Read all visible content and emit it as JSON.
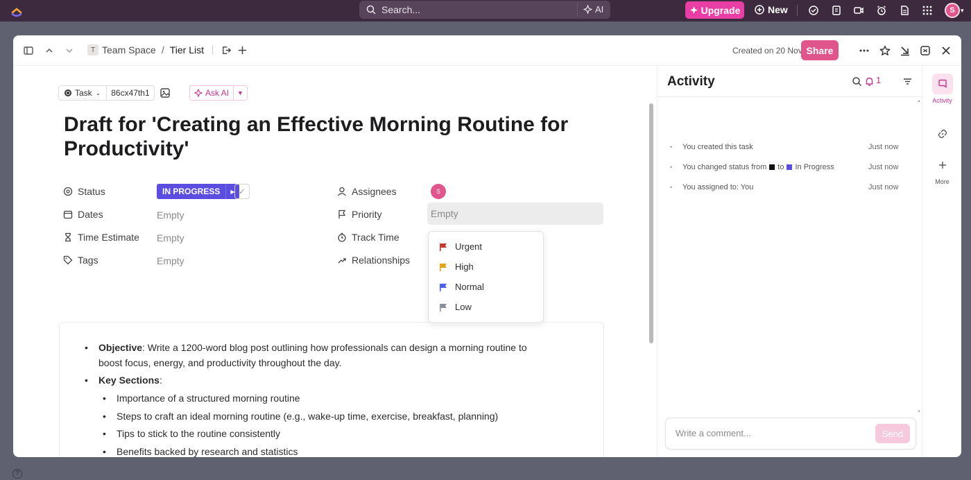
{
  "topbar": {
    "search_placeholder": "Search...",
    "ai_label": "AI",
    "upgrade_label": "Upgrade",
    "new_label": "New",
    "avatar_initial": "S"
  },
  "breadcrumb": {
    "space_initial": "T",
    "space": "Team Space",
    "separator": "/",
    "list": "Tier List"
  },
  "header": {
    "created": "Created on 20 Nov",
    "share_label": "Share"
  },
  "task": {
    "type_label": "Task",
    "task_id": "86cx47th1",
    "ask_ai_label": "Ask AI",
    "title": "Draft for 'Creating an Effective Morning Routine for Productivity'"
  },
  "fields": {
    "status_label": "Status",
    "status_value": "IN PROGRESS",
    "dates_label": "Dates",
    "dates_value": "Empty",
    "time_estimate_label": "Time Estimate",
    "time_estimate_value": "Empty",
    "tags_label": "Tags",
    "tags_value": "Empty",
    "assignees_label": "Assignees",
    "assignee_initial": "S",
    "priority_label": "Priority",
    "priority_value": "Empty",
    "track_time_label": "Track Time",
    "relationships_label": "Relationships"
  },
  "priority_menu": [
    {
      "label": "Urgent",
      "color": "#c0392b"
    },
    {
      "label": "High",
      "color": "#e0a21b"
    },
    {
      "label": "Normal",
      "color": "#4a5ee6"
    },
    {
      "label": "Low",
      "color": "#8a8f9c"
    }
  ],
  "description": {
    "objective_label": "Objective",
    "objective_text": ": Write a 1200-word blog post outlining how professionals can design a morning routine to",
    "objective_text2": "boost focus, energy, and productivity throughout the day.",
    "sections_label": "Key Sections",
    "sections_colon": ":",
    "sections": [
      "Importance of a structured morning routine",
      "Steps to craft an ideal morning routine (e.g., wake-up time, exercise, breakfast, planning)",
      "Tips to stick to the routine consistently",
      "Benefits backed by research and statistics"
    ]
  },
  "activity": {
    "title": "Activity",
    "notification_count": "1",
    "items": [
      {
        "text": "You created this task",
        "time": "Just now"
      },
      {
        "text_before": "You changed status from",
        "text_mid": "to",
        "text_after": "In Progress",
        "time": "Just now"
      },
      {
        "text": "You assigned to: You",
        "time": "Just now"
      }
    ],
    "comment_placeholder": "Write a comment...",
    "send_label": "Send"
  },
  "rail": {
    "activity_label": "Activity",
    "more_label": "More"
  },
  "colors": {
    "accent": "#e0558c",
    "status": "#5b4de0",
    "topbar": "#3d2a3f"
  }
}
